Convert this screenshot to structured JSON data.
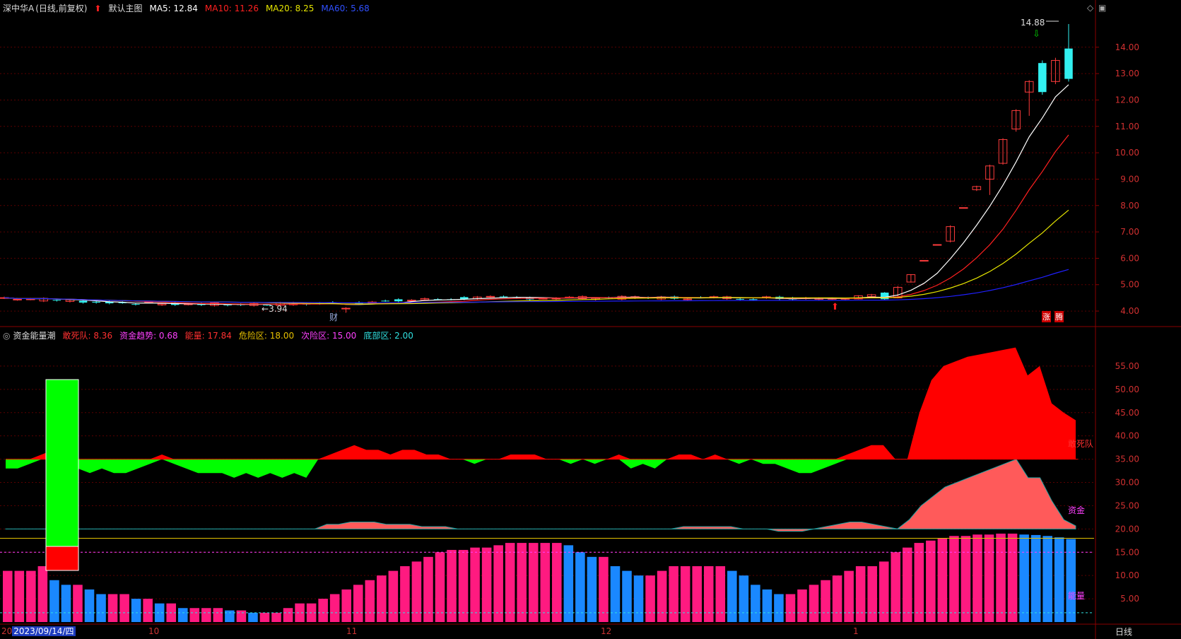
{
  "header": {
    "stock_name": "深中华A",
    "period_info": "(日线,前复权)",
    "main_chart_label": "默认主图",
    "ma5": "MA5: 12.84",
    "ma10": "MA10: 11.26",
    "ma20": "MA20: 8.25",
    "ma60": "MA60: 5.68"
  },
  "indicator_header": {
    "name": "资金能量潮",
    "gansidui": "敢死队: 8.36",
    "zijin_trend": "资金趋势: 0.68",
    "energy": "能量: 17.84",
    "danger": "危险区: 18.00",
    "second_danger": "次险区: 15.00",
    "bottom": "底部区: 2.00"
  },
  "annotations": {
    "high_price": "14.88",
    "low_price": "3.94",
    "finance_marker": "财",
    "zhangting": "涨",
    "zhengting": "腾",
    "label_gansidui": "敢死队",
    "label_zijin": "资金",
    "label_energy": "能量"
  },
  "axis": {
    "date_cursor": "2023/09/14/四",
    "cursor_prefix": "20",
    "months": [
      "10",
      "11",
      "12",
      "1"
    ],
    "period_button": "日线"
  },
  "colors": {
    "up": "#ff3c3c",
    "down": "#32f0f0",
    "ma5": "#ffffff",
    "ma10": "#ff2020",
    "ma20": "#e6e600",
    "ma60": "#2020ff",
    "bar_pink": "#ff1a80",
    "bar_blue": "#1a88ff",
    "bg": "#000000",
    "grid": "#5a0000"
  },
  "chart_data": [
    {
      "type": "candlestick",
      "y_ticks": [
        "14.00",
        "13.00",
        "12.00",
        "11.00",
        "10.00",
        "9.00",
        "8.00",
        "7.00",
        "6.00",
        "5.00",
        "4.00"
      ],
      "ylim": [
        3.6,
        15.2
      ],
      "flat_segment": {
        "count": 64,
        "base": 4.5,
        "low_point": 3.94
      },
      "rally_candles": [
        {
          "o": 4.45,
          "c": 4.48,
          "h": 4.5,
          "l": 4.42
        },
        {
          "o": 4.46,
          "c": 4.58,
          "h": 4.6,
          "l": 4.44
        },
        {
          "o": 4.55,
          "c": 4.62,
          "h": 4.65,
          "l": 4.5
        },
        {
          "o": 4.7,
          "c": 4.45,
          "h": 4.72,
          "l": 4.42
        },
        {
          "o": 4.5,
          "c": 4.9,
          "h": 4.95,
          "l": 4.48
        },
        {
          "o": 5.1,
          "c": 5.38,
          "h": 5.4,
          "l": 5.08
        },
        {
          "o": 5.92,
          "c": 5.92,
          "h": 5.92,
          "l": 5.92
        },
        {
          "o": 6.52,
          "c": 6.52,
          "h": 6.52,
          "l": 6.52
        },
        {
          "o": 6.65,
          "c": 7.2,
          "h": 7.25,
          "l": 6.6
        },
        {
          "o": 7.92,
          "c": 7.92,
          "h": 7.92,
          "l": 7.92
        },
        {
          "o": 8.6,
          "c": 8.72,
          "h": 8.75,
          "l": 8.55
        },
        {
          "o": 9.0,
          "c": 9.5,
          "h": 9.55,
          "l": 8.4
        },
        {
          "o": 9.6,
          "c": 10.5,
          "h": 10.55,
          "l": 9.55
        },
        {
          "o": 10.9,
          "c": 11.6,
          "h": 11.65,
          "l": 10.8
        },
        {
          "o": 12.3,
          "c": 12.7,
          "h": 12.75,
          "l": 11.4
        },
        {
          "o": 13.4,
          "c": 12.3,
          "h": 13.5,
          "l": 12.2
        },
        {
          "o": 12.7,
          "c": 13.5,
          "h": 13.6,
          "l": 12.6
        },
        {
          "o": 13.95,
          "c": 12.8,
          "h": 14.88,
          "l": 12.7
        }
      ],
      "ma_latest": {
        "MA5": 12.84,
        "MA10": 11.26,
        "MA20": 8.25,
        "MA60": 5.68
      }
    },
    {
      "type": "indicator",
      "y_ticks": [
        "55.00",
        "50.00",
        "45.00",
        "40.00",
        "35.00",
        "30.00",
        "25.00",
        "20.00",
        "15.00",
        "10.00",
        "5.00"
      ],
      "ylim": [
        0,
        60
      ],
      "gansidui_baseline": 35,
      "zijin_baseline": 20,
      "danger_line": 18,
      "second_danger_line": 15,
      "bottom_line": 2,
      "energy_bars": [
        11,
        11,
        11,
        12,
        9,
        8,
        8,
        7,
        6,
        6,
        6,
        5,
        5,
        4,
        4,
        3,
        3,
        3,
        3,
        2.5,
        2.5,
        2,
        2,
        2,
        3,
        4,
        4,
        5,
        6,
        7,
        8,
        9,
        10,
        11,
        12,
        13,
        14,
        15,
        15.5,
        15.5,
        16,
        16,
        16.5,
        17,
        17,
        17,
        17,
        17,
        16.5,
        15,
        14,
        14,
        12,
        11,
        10,
        10,
        11,
        12,
        12,
        12,
        12,
        12,
        11,
        10,
        8,
        7,
        6,
        6,
        7,
        8,
        9,
        10,
        11,
        12,
        12,
        13,
        15,
        16,
        17,
        17.5,
        18,
        18.5,
        18.5,
        18.8,
        18.8,
        19,
        19,
        18.8,
        18.7,
        18.5,
        18.2,
        17.84
      ],
      "gansidui_wave": [
        -2,
        -2,
        -1,
        1,
        2,
        -1,
        -2,
        -3,
        -2,
        -3,
        -3,
        -2,
        -1,
        1,
        -1,
        -2,
        -3,
        -3,
        -3,
        -4,
        -3,
        -4,
        -3,
        -4,
        -3,
        -4,
        0,
        1,
        2,
        3,
        2,
        2,
        1,
        2,
        2,
        1,
        1,
        0,
        0,
        -1,
        0,
        0,
        1,
        1,
        1,
        0,
        0,
        -1,
        0,
        -1,
        0,
        1,
        -2,
        -1,
        -2,
        0,
        1,
        1,
        0,
        1,
        0,
        -1,
        0,
        -1,
        -1,
        -2,
        -3,
        -3,
        -2,
        -1,
        1,
        2,
        3,
        3,
        0,
        0,
        10,
        17,
        20,
        21,
        22,
        22.5,
        23,
        23.5,
        24,
        18,
        20,
        12,
        10,
        8.36
      ],
      "zijin_wave": [
        0,
        0,
        0,
        0,
        0,
        0,
        0,
        0,
        0,
        0,
        0,
        0,
        0,
        0,
        0,
        0,
        0,
        0,
        0,
        0,
        0,
        0,
        0,
        0,
        0,
        0,
        0,
        1,
        1,
        1.5,
        1.5,
        1.5,
        1,
        1,
        1,
        0.5,
        0.5,
        0.5,
        0,
        0,
        0,
        0,
        0,
        0,
        0,
        0,
        0,
        0,
        0,
        0,
        0,
        0,
        0,
        0,
        0,
        0,
        0,
        0.5,
        0.5,
        0.5,
        0.5,
        0.5,
        0,
        0,
        0,
        -0.5,
        -0.5,
        -0.5,
        0,
        0.5,
        1,
        1.5,
        1.5,
        1,
        0.5,
        0,
        2,
        5,
        7,
        9,
        10,
        11,
        12,
        13,
        14,
        15,
        11,
        11,
        6,
        2,
        0.68
      ]
    }
  ]
}
